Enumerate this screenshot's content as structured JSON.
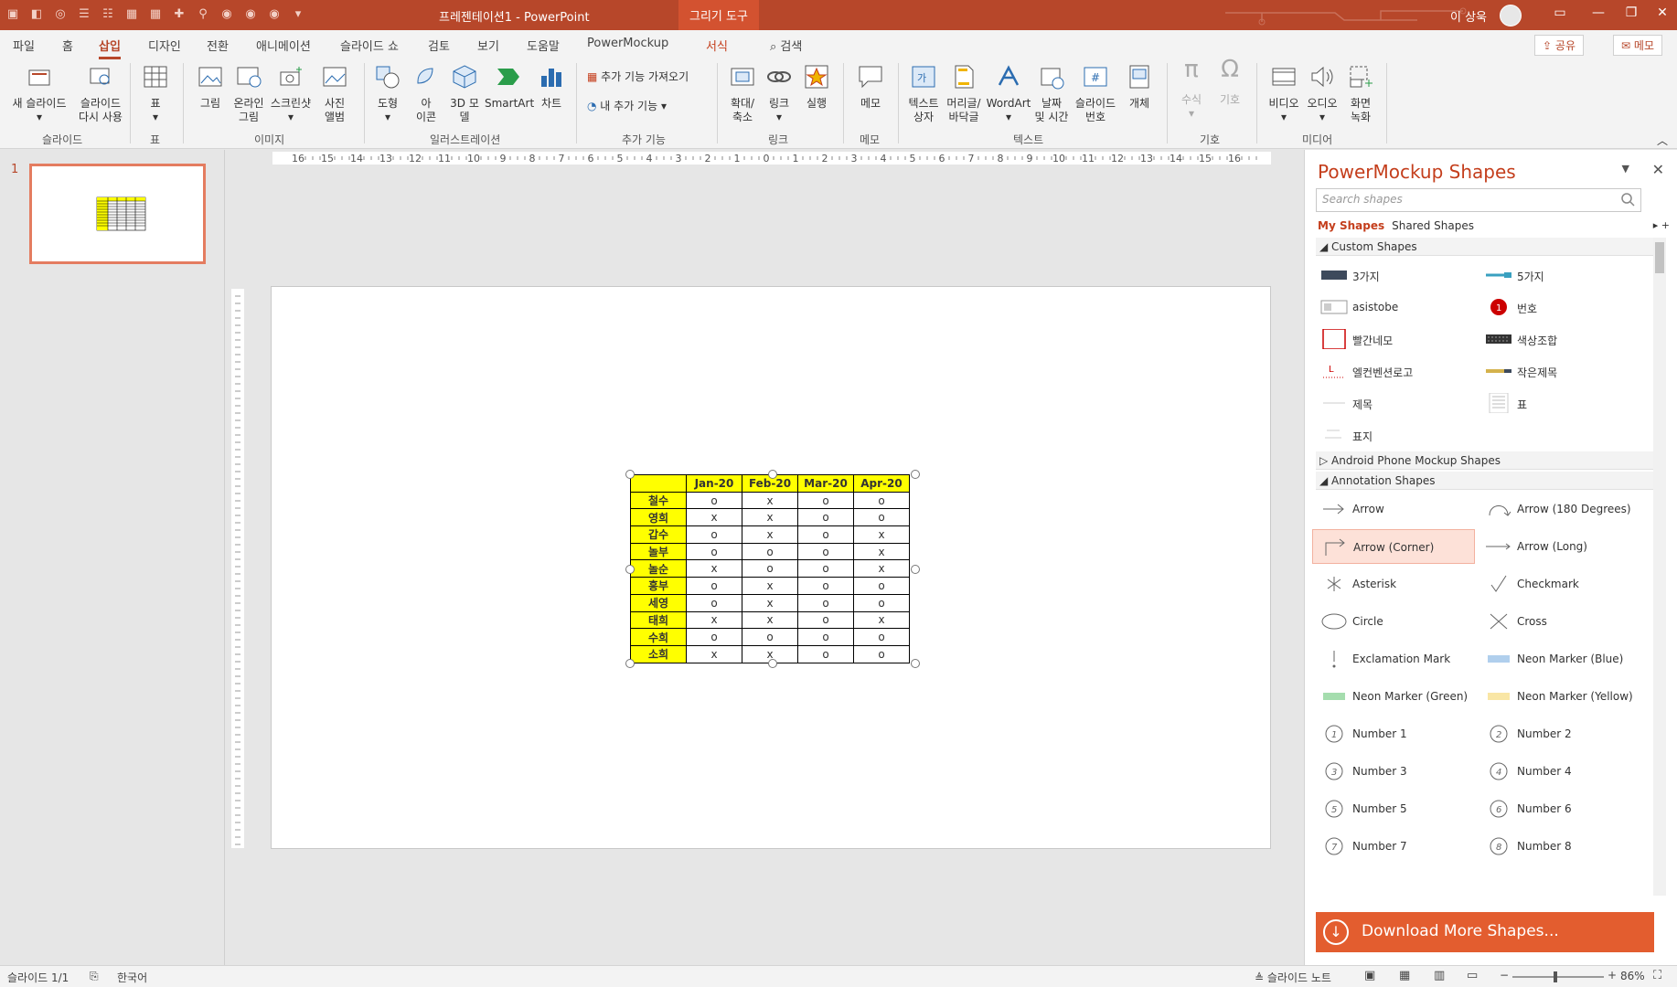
{
  "app": {
    "doc_title": "프레젠테이션1 - PowerPoint",
    "context_tool": "그리기 도구",
    "user_name": "이 상욱"
  },
  "tabs": [
    "파일",
    "홈",
    "삽입",
    "디자인",
    "전환",
    "애니메이션",
    "슬라이드 쇼",
    "검토",
    "보기",
    "도움말",
    "PowerMockup",
    "서식"
  ],
  "search_tab": "검색",
  "share": "공유",
  "memo_btn": "메모",
  "ribbon": {
    "new_slide": "새 슬라이드",
    "reuse": "슬라이드\n다시 사용",
    "table": "표",
    "picture": "그림",
    "online_pic": "온라인\n그림",
    "screenshot": "스크린샷",
    "album": "사진\n앨범",
    "shapes": "도형",
    "icons": "아\n이콘",
    "model3d": "3D 모\n델",
    "smartart": "SmartArt",
    "chart": "차트",
    "get_addins": "추가 기능 가져오기",
    "my_addins": "내 추가 기능",
    "zoom": "확대/\n축소",
    "link": "링크",
    "action": "실행",
    "comment": "메모",
    "textbox": "텍스트\n상자",
    "headerfooter": "머리글/\n바닥글",
    "wordart": "WordArt",
    "datetime": "날짜\n및 시간",
    "slidenum": "슬라이드\n번호",
    "object": "개체",
    "equation": "수식",
    "symbol": "기호",
    "video": "비디오",
    "audio": "오디오",
    "screenrec": "화면\n녹화",
    "groups": {
      "slides": "슬라이드",
      "table": "표",
      "images": "이미지",
      "illustrations": "일러스트레이션",
      "addins": "추가 기능",
      "links": "링크",
      "comments": "메모",
      "text": "텍스트",
      "symbols": "기호",
      "media": "미디어"
    }
  },
  "thumb_number": "1",
  "ruler_labels": [
    "16",
    "15",
    "14",
    "13",
    "12",
    "11",
    "10",
    "9",
    "8",
    "7",
    "6",
    "5",
    "4",
    "3",
    "2",
    "1",
    "0",
    "1",
    "2",
    "3",
    "4",
    "5",
    "6",
    "7",
    "8",
    "9",
    "10",
    "11",
    "12",
    "13",
    "14",
    "15",
    "16"
  ],
  "table": {
    "headers": [
      "",
      "Jan-20",
      "Feb-20",
      "Mar-20",
      "Apr-20"
    ],
    "rows": [
      [
        "철수",
        "o",
        "x",
        "o",
        "o"
      ],
      [
        "영희",
        "x",
        "x",
        "o",
        "o"
      ],
      [
        "갑수",
        "o",
        "x",
        "o",
        "x"
      ],
      [
        "놀부",
        "o",
        "o",
        "o",
        "x"
      ],
      [
        "놀순",
        "x",
        "o",
        "o",
        "x"
      ],
      [
        "흥부",
        "o",
        "x",
        "o",
        "o"
      ],
      [
        "세영",
        "o",
        "x",
        "o",
        "o"
      ],
      [
        "태희",
        "x",
        "x",
        "o",
        "x"
      ],
      [
        "수희",
        "o",
        "o",
        "o",
        "o"
      ],
      [
        "소희",
        "x",
        "x",
        "o",
        "o"
      ]
    ]
  },
  "pane": {
    "title": "PowerMockup Shapes",
    "search_placeholder": "Search shapes",
    "my_shapes": "My Shapes",
    "shared_shapes": "Shared Shapes",
    "sec_custom": "Custom Shapes",
    "sec_android": "Android Phone Mockup Shapes",
    "sec_annotation": "Annotation Shapes",
    "custom": [
      "3가지",
      "5가지",
      "asistobe",
      "번호",
      "빨간네모",
      "색상조합",
      "엘컨벤션로고",
      "작은제목",
      "제목",
      "표",
      "표지"
    ],
    "annotation": [
      "Arrow",
      "Arrow (180 Degrees)",
      "Arrow (Corner)",
      "Arrow (Long)",
      "Asterisk",
      "Checkmark",
      "Circle",
      "Cross",
      "Exclamation Mark",
      "Neon Marker (Blue)",
      "Neon Marker (Green)",
      "Neon Marker (Yellow)",
      "Number 1",
      "Number 2",
      "Number 3",
      "Number 4",
      "Number 5",
      "Number 6",
      "Number 7",
      "Number 8"
    ],
    "download": "Download More Shapes..."
  },
  "status": {
    "slide": "슬라이드 1/1",
    "lang": "한국어",
    "notes": "슬라이드 노트",
    "zoom": "86%"
  }
}
